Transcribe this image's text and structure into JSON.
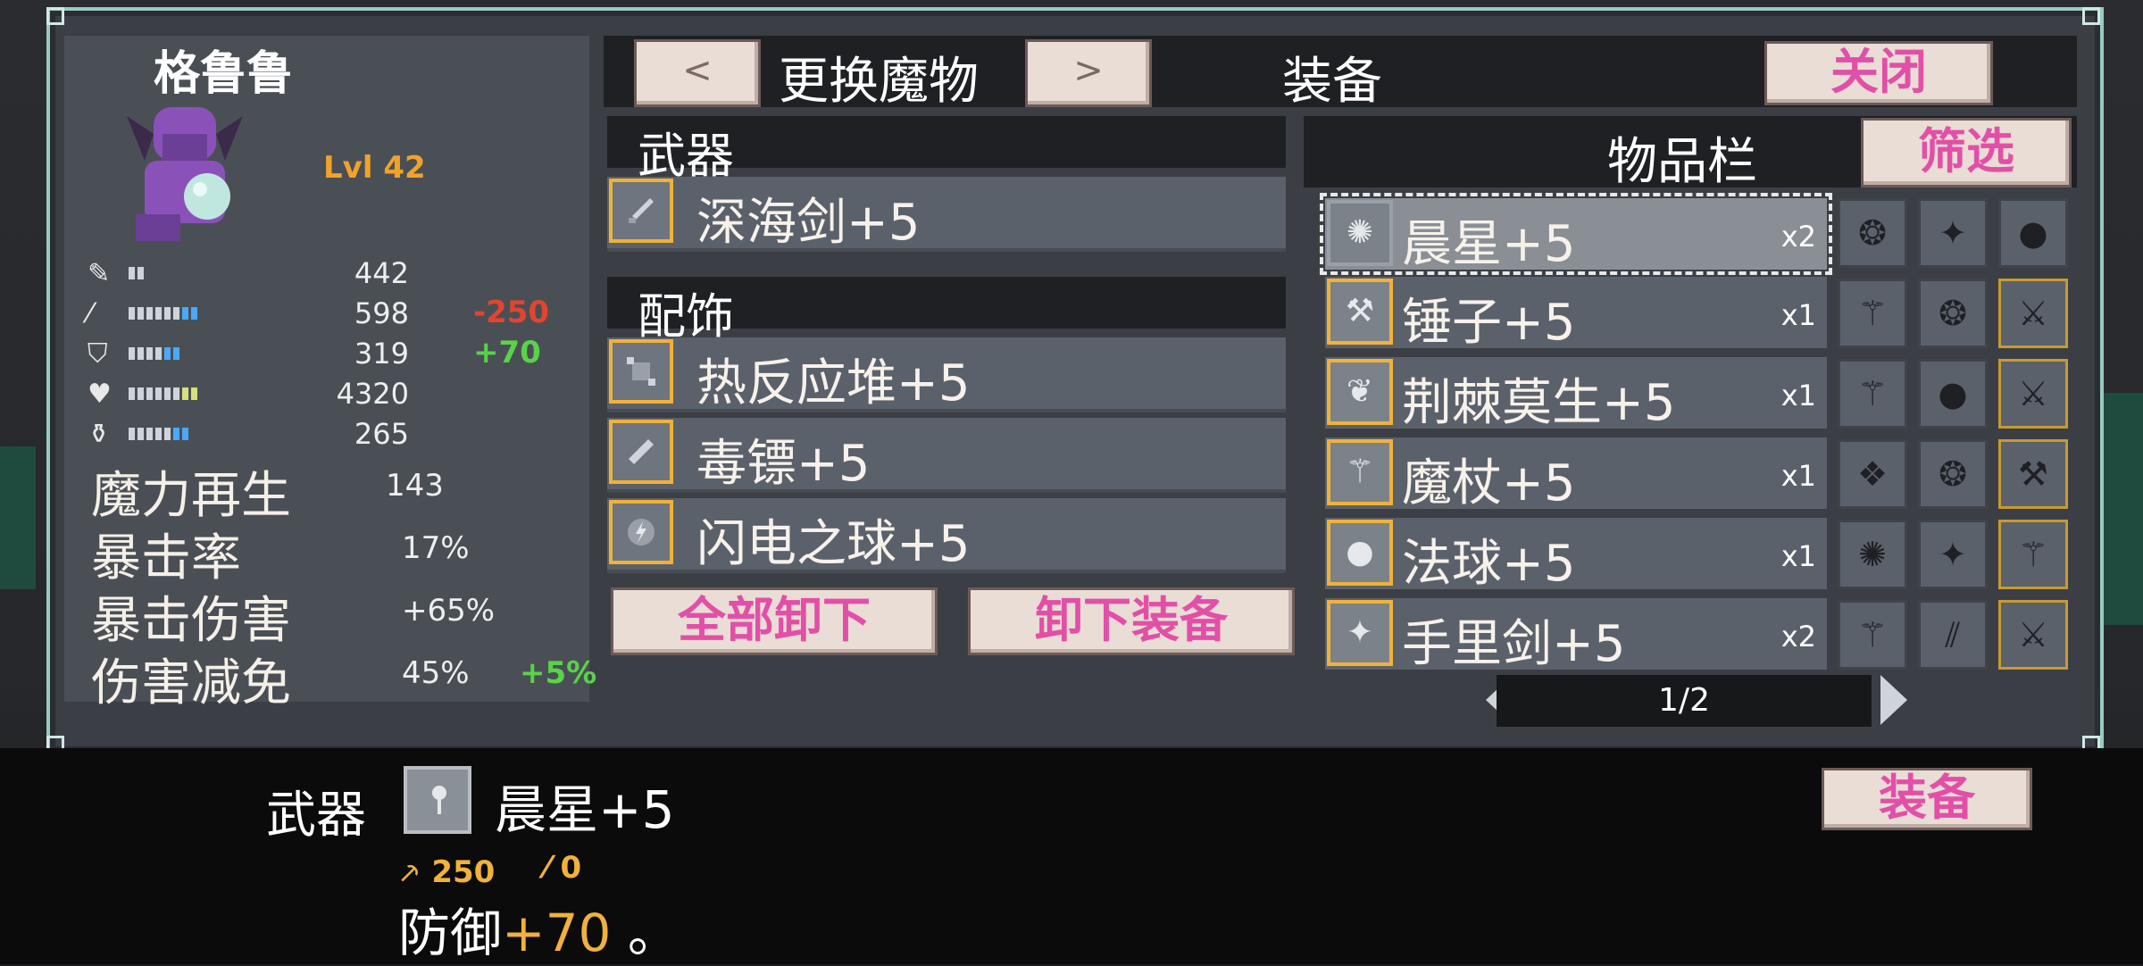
{
  "character": {
    "name": "格鲁鲁",
    "level": "Lvl 42",
    "stats": [
      {
        "icon": "sword-icon",
        "value": "442",
        "mod": "",
        "mod_color": "",
        "bars": 2
      },
      {
        "icon": "wand-icon",
        "value": "598",
        "mod": "-250",
        "mod_color": "#e2452f",
        "bars": 8
      },
      {
        "icon": "shield-icon",
        "value": "319",
        "mod": "+70",
        "mod_color": "#5ad24a",
        "bars": 6
      },
      {
        "icon": "heart-icon",
        "value": "4320",
        "mod": "",
        "mod_color": "",
        "bars": 8
      },
      {
        "icon": "potion-icon",
        "value": "265",
        "mod": "",
        "mod_color": "",
        "bars": 7
      }
    ],
    "extra": [
      {
        "label": "魔力再生",
        "value": "143",
        "mod": ""
      },
      {
        "label": "暴击率",
        "value": "17%",
        "mod": ""
      },
      {
        "label": "暴击伤害",
        "value": "+65%",
        "mod": ""
      },
      {
        "label": "伤害减免",
        "value": "45%",
        "mod": "+5%"
      }
    ]
  },
  "header": {
    "prev": "<",
    "change_monster": "更换魔物",
    "next": ">",
    "title": "装备",
    "close": "关闭"
  },
  "equipment": {
    "weapon_heading": "武器",
    "weapon": "深海剑+5",
    "accessory_heading": "配饰",
    "accessories": [
      "热反应堆+5",
      "毒镖+5",
      "闪电之球+5"
    ],
    "unequip_all": "全部卸下",
    "unequip": "卸下装备"
  },
  "inventory": {
    "heading": "物品栏",
    "filter": "筛选",
    "items": [
      {
        "name": "晨星+5",
        "qty": "x2",
        "icon": "morningstar-icon",
        "selected": true
      },
      {
        "name": "锤子+5",
        "qty": "x1",
        "icon": "hammer-icon",
        "selected": false
      },
      {
        "name": "荆棘莫生+5",
        "qty": "x1",
        "icon": "thorn-icon",
        "selected": false
      },
      {
        "name": "魔杖+5",
        "qty": "x1",
        "icon": "staff-icon",
        "selected": false
      },
      {
        "name": "法球+5",
        "qty": "x1",
        "icon": "orb-icon",
        "selected": false
      },
      {
        "name": "手里剑+5",
        "qty": "x2",
        "icon": "shuriken-icon",
        "selected": false
      }
    ],
    "page": "1/2"
  },
  "detail": {
    "slot_label": "武器",
    "item_name": "晨星+5",
    "attack": "250",
    "magic": "0",
    "desc_prefix": "防御",
    "desc_value": "+70",
    "desc_suffix": "。",
    "equip": "装备"
  },
  "colors": {
    "accent_pink": "#e24fa7",
    "frame_teal": "#9ac9c4",
    "gold": "#f0b23a"
  }
}
